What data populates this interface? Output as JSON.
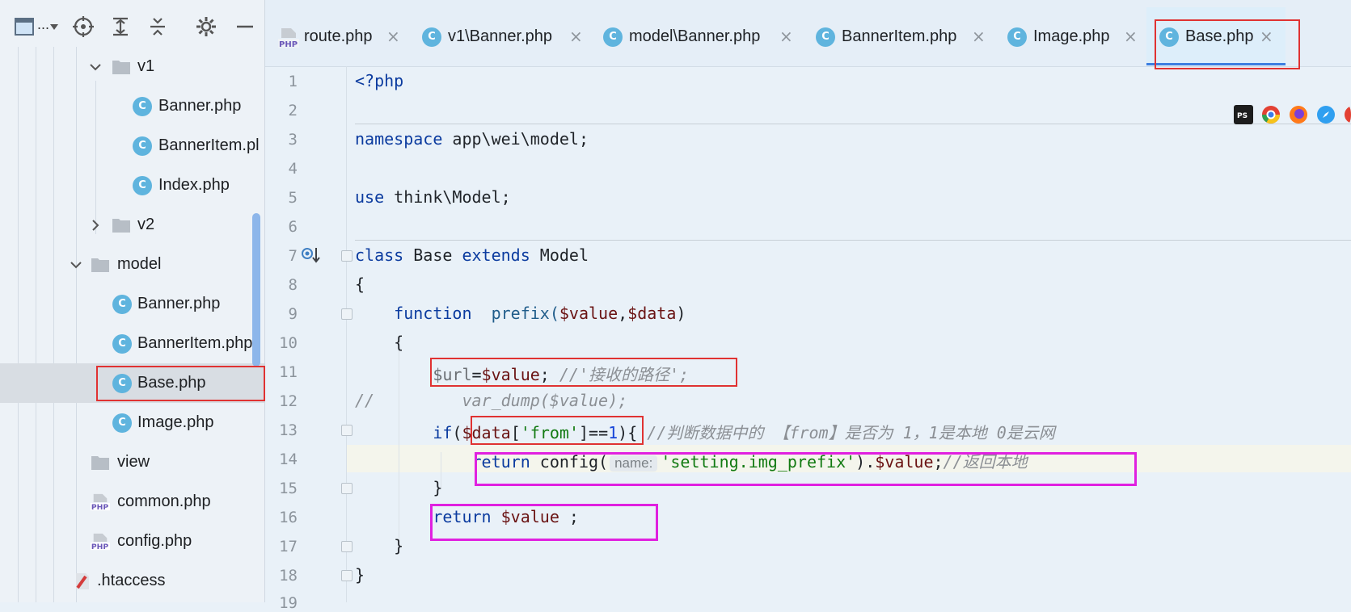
{
  "tree": {
    "items": [
      {
        "label": "v1",
        "type": "folder",
        "expanded": true
      },
      {
        "label": "Banner.php",
        "type": "class"
      },
      {
        "label": "BannerItem.pl",
        "type": "class"
      },
      {
        "label": "Index.php",
        "type": "class"
      },
      {
        "label": "v2",
        "type": "folder",
        "expanded": false
      },
      {
        "label": "model",
        "type": "folder",
        "expanded": true
      },
      {
        "label": "Banner.php",
        "type": "class"
      },
      {
        "label": "BannerItem.php",
        "type": "class"
      },
      {
        "label": "Base.php",
        "type": "class",
        "selected": true
      },
      {
        "label": "Image.php",
        "type": "class"
      },
      {
        "label": "view",
        "type": "folder"
      },
      {
        "label": "common.php",
        "type": "php"
      },
      {
        "label": "config.php",
        "type": "php"
      },
      {
        "label": ".htaccess",
        "type": "htaccess"
      }
    ]
  },
  "toolbar": {
    "project_label": "..."
  },
  "tabs": [
    {
      "label": "route.php",
      "type": "php"
    },
    {
      "label": "v1\\Banner.php",
      "type": "class"
    },
    {
      "label": "model\\Banner.php",
      "type": "class"
    },
    {
      "label": "BannerItem.php",
      "type": "class"
    },
    {
      "label": "Image.php",
      "type": "class"
    },
    {
      "label": "Base.php",
      "type": "class",
      "active": true
    }
  ],
  "tab_close_glyph": "×",
  "icons": {
    "php_badge": "PHP",
    "browser_icons": [
      "phpstorm-icon",
      "chrome-icon",
      "firefox-icon",
      "safari-icon"
    ]
  },
  "editor": {
    "line_numbers": [
      "1",
      "2",
      "3",
      "4",
      "5",
      "6",
      "7",
      "8",
      "9",
      "10",
      "11",
      "12",
      "13",
      "14",
      "15",
      "16",
      "17",
      "18",
      "19"
    ],
    "code": {
      "l1": "<?php",
      "l3_kw": "namespace",
      "l3_rest": " app\\wei\\model;",
      "l5_kw": "use",
      "l5_rest": " think\\Model;",
      "l7_kw1": "class",
      "l7_name": " Base ",
      "l7_kw2": "extends",
      "l7_parent": " Model",
      "l8": "{",
      "l9_indent": "    ",
      "l9_kw": "function",
      "l9_name": "  prefix(",
      "l9_p1": "$value",
      "l9_comma": ",",
      "l9_p2": "$data",
      "l9_close": ")",
      "l10": "    {",
      "l11_indent": "        ",
      "l11_var": "$url",
      "l11_eq": "=",
      "l11_val": "$value",
      "l11_semi": "; ",
      "l11_cmt": "//'接收的路径';",
      "l12_cmt": "//         var_dump($value);",
      "l13_indent": "        ",
      "l13_kw": "if",
      "l13_open": "(",
      "l13_var": "$data",
      "l13_br": "[",
      "l13_str": "'from'",
      "l13_br2": "]==",
      "l13_num": "1",
      "l13_close": "){ ",
      "l13_cmt": "//判断数据中的 【from】是否为 1，1是本地 0是云网",
      "l14_indent": "            ",
      "l14_kw": "return",
      "l14_fn": " config(",
      "l14_hint": "name:",
      "l14_str": "'setting.img_prefix'",
      "l14_dot": ").",
      "l14_var": "$value",
      "l14_semi": ";",
      "l14_cmt": "//返回本地",
      "l15": "        }",
      "l16_indent": "        ",
      "l16_kw": "return",
      "l16_var": " $value",
      "l16_semi": " ;",
      "l17": "    }",
      "l18": "}"
    }
  },
  "colors": {
    "annotation_red": "#e03232",
    "annotation_magenta": "#e020e0",
    "class_icon": "#5fb4de",
    "keyword": "#0b3b9f",
    "variable": "#6a1313",
    "string": "#127a12"
  }
}
